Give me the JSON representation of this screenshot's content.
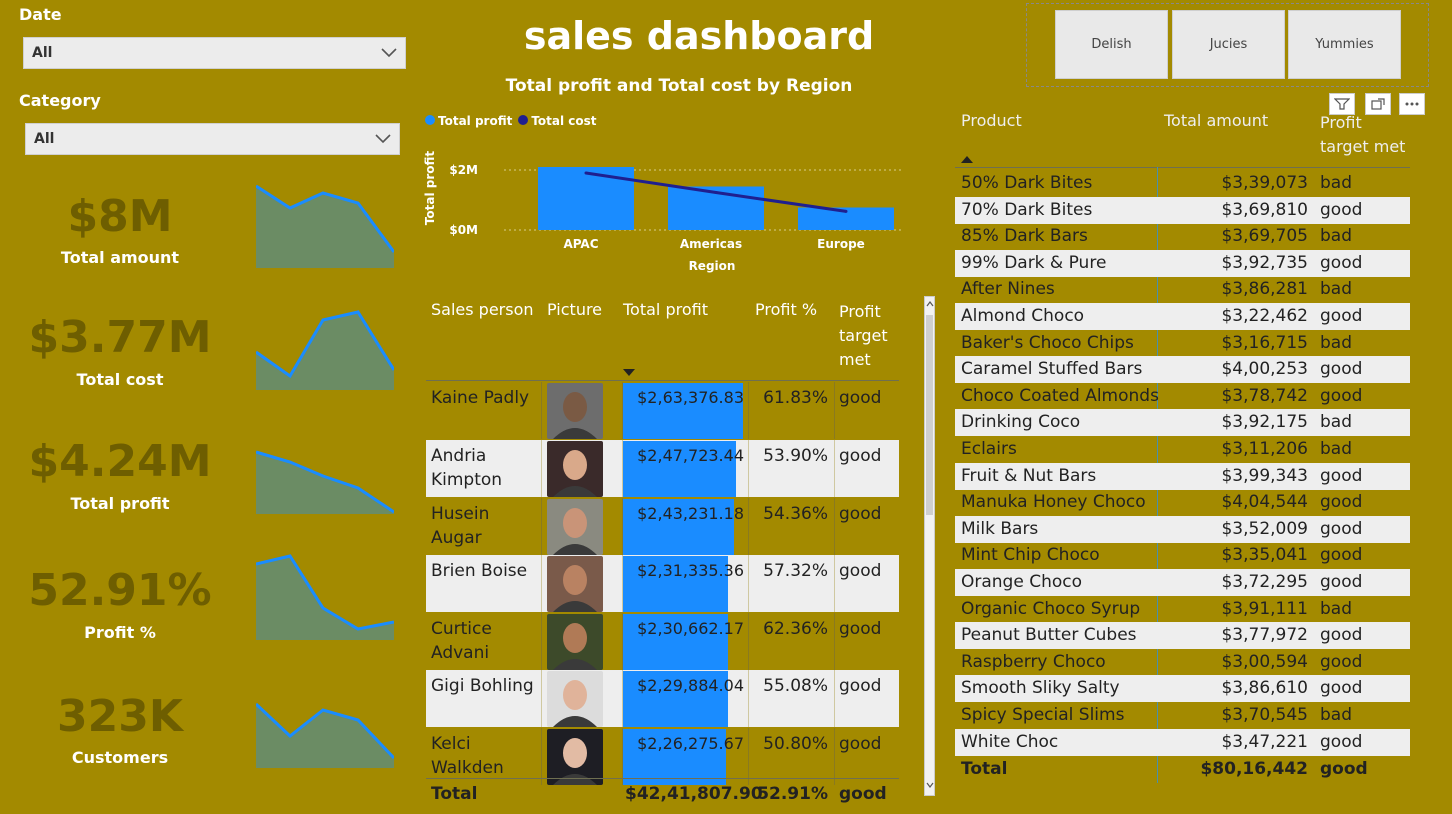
{
  "slicers": {
    "date": {
      "label": "Date",
      "value": "All"
    },
    "category": {
      "label": "Category",
      "value": "All"
    }
  },
  "kpis": [
    {
      "value": "$8M",
      "label": "Total amount"
    },
    {
      "value": "$3.77M",
      "label": "Total cost"
    },
    {
      "value": "$4.24M",
      "label": "Total profit"
    },
    {
      "value": "52.91%",
      "label": "Profit %"
    },
    {
      "value": "323K",
      "label": "Customers"
    }
  ],
  "title": "sales dashboard",
  "brands": [
    "Delish",
    "Jucies",
    "Yummies"
  ],
  "chart_data": {
    "type": "bar",
    "title": "Total profit and Total cost by Region",
    "xlabel": "Region",
    "ylabel": "Total profit",
    "categories": [
      "APAC",
      "Americas",
      "Europe"
    ],
    "series": [
      {
        "name": "Total profit",
        "values": [
          2.1,
          1.45,
          0.75
        ],
        "color": "#1a8cff",
        "kind": "bar"
      },
      {
        "name": "Total cost",
        "values": [
          1.9,
          1.25,
          0.62
        ],
        "color": "#1f1f8f",
        "kind": "line"
      }
    ],
    "yticks": [
      "$2M",
      "$0M"
    ],
    "ylim": [
      0,
      2.2
    ],
    "grid": true,
    "legend": "top-left"
  },
  "sales_table": {
    "headers": [
      "Sales person",
      "Picture",
      "Total profit",
      "Profit %",
      "Profit target met"
    ],
    "max_profit": 263376.83,
    "rows": [
      {
        "name": "Kaine Padly",
        "profit": "$2,63,376.83",
        "profit_value": 263376.83,
        "pct": "61.83%",
        "met": "good",
        "skin": "#7a5a44",
        "bg": "#6d6d6d"
      },
      {
        "name": "Andria Kimpton",
        "profit": "$2,47,723.44",
        "profit_value": 247723.44,
        "pct": "53.90%",
        "met": "good",
        "skin": "#d9a98a",
        "bg": "#3a2a2a"
      },
      {
        "name": "Husein Augar",
        "profit": "$2,43,231.18",
        "profit_value": 243231.18,
        "pct": "54.36%",
        "met": "good",
        "skin": "#c99478",
        "bg": "#8a8a80"
      },
      {
        "name": "Brien Boise",
        "profit": "$2,31,335.36",
        "profit_value": 231335.36,
        "pct": "57.32%",
        "met": "good",
        "skin": "#b98262",
        "bg": "#7a5a4a"
      },
      {
        "name": "Curtice Advani",
        "profit": "$2,30,662.17",
        "profit_value": 230662.17,
        "pct": "62.36%",
        "met": "good",
        "skin": "#b07a56",
        "bg": "#3d4a2a"
      },
      {
        "name": "Gigi Bohling",
        "profit": "$2,29,884.04",
        "profit_value": 229884.04,
        "pct": "55.08%",
        "met": "good",
        "skin": "#e0b39a",
        "bg": "#dcdcdc"
      },
      {
        "name": "Kelci Walkden",
        "profit": "$2,26,275.67",
        "profit_value": 226275.67,
        "pct": "50.80%",
        "met": "good",
        "skin": "#e2bba4",
        "bg": "#1e1e24"
      }
    ],
    "total": {
      "label": "Total",
      "profit": "$42,41,807.90",
      "pct": "52.91%",
      "met": "good"
    }
  },
  "product_table": {
    "headers": [
      "Product",
      "Total amount",
      "Profit target met"
    ],
    "rows": [
      [
        "50% Dark Bites",
        "$3,39,073",
        "bad"
      ],
      [
        "70% Dark Bites",
        "$3,69,810",
        "good"
      ],
      [
        "85% Dark Bars",
        "$3,69,705",
        "bad"
      ],
      [
        "99% Dark & Pure",
        "$3,92,735",
        "good"
      ],
      [
        "After Nines",
        "$3,86,281",
        "bad"
      ],
      [
        "Almond Choco",
        "$3,22,462",
        "good"
      ],
      [
        "Baker's Choco Chips",
        "$3,16,715",
        "bad"
      ],
      [
        "Caramel Stuffed Bars",
        "$4,00,253",
        "good"
      ],
      [
        "Choco Coated Almonds",
        "$3,78,742",
        "good"
      ],
      [
        "Drinking Coco",
        "$3,92,175",
        "bad"
      ],
      [
        "Eclairs",
        "$3,11,206",
        "bad"
      ],
      [
        "Fruit & Nut Bars",
        "$3,99,343",
        "good"
      ],
      [
        "Manuka Honey Choco",
        "$4,04,544",
        "good"
      ],
      [
        "Milk Bars",
        "$3,52,009",
        "good"
      ],
      [
        "Mint Chip Choco",
        "$3,35,041",
        "good"
      ],
      [
        "Orange Choco",
        "$3,72,295",
        "good"
      ],
      [
        "Organic Choco Syrup",
        "$3,91,111",
        "bad"
      ],
      [
        "Peanut Butter Cubes",
        "$3,77,972",
        "good"
      ],
      [
        "Raspberry Choco",
        "$3,00,594",
        "good"
      ],
      [
        "Smooth Sliky Salty",
        "$3,86,610",
        "good"
      ],
      [
        "Spicy Special Slims",
        "$3,70,545",
        "bad"
      ],
      [
        "White Choc",
        "$3,47,221",
        "good"
      ]
    ],
    "total": [
      "Total",
      "$80,16,442",
      "good"
    ]
  },
  "colors": {
    "background": "#a38a00",
    "bar": "#1a8cff",
    "line": "#1f1f8f",
    "kpi": "#6e5e00",
    "spark_fill": "#6b8c64",
    "spark_line": "#1a8cff"
  }
}
